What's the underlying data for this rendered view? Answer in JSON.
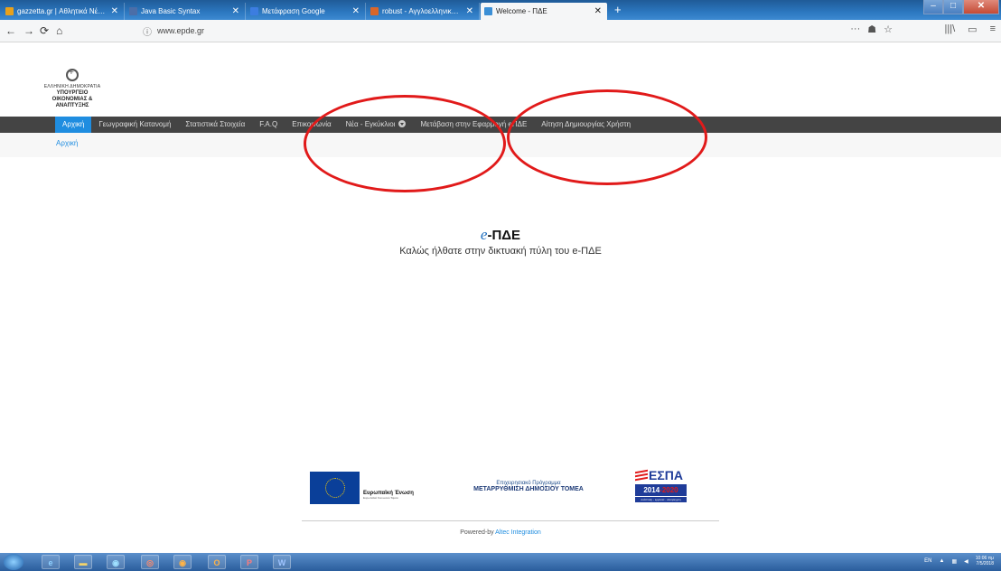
{
  "browser": {
    "tabs": [
      {
        "title": "gazzetta.gr | Αθλητικά Νέα | Εκ",
        "favicon_color": "#e8a11c"
      },
      {
        "title": "Java Basic Syntax",
        "favicon_color": "#4b6ea8"
      },
      {
        "title": "Μετάφραση Google",
        "favicon_color": "#3c7de0"
      },
      {
        "title": "robust - Αγγλοελληνικό Λεξικό",
        "favicon_color": "#d9662a"
      },
      {
        "title": "Welcome - ΠΔΕ",
        "favicon_color": "#3b8fd6"
      }
    ],
    "close_glyph": "✕",
    "new_tab_glyph": "+",
    "url": "www.epde.gr",
    "nav": {
      "back": "←",
      "forward": "→",
      "reload": "⟳",
      "home": "⌂",
      "info": "ⓘ"
    },
    "url_actions": [
      "···",
      "☗",
      "☆"
    ],
    "toolbar_icons": [
      "|||\\",
      "▭",
      "≡"
    ],
    "window_controls": {
      "min": "‒",
      "max": "□",
      "close": "✕"
    }
  },
  "site": {
    "logo": {
      "line1": "ΕΛΛΗΝΙΚΗ ΔΗΜΟΚΡΑΤΙΑ",
      "line2": "ΥΠΟΥΡΓΕΙΟ",
      "line3": "ΟΙΚΟΝΟΜΙΑΣ & ΑΝΑΠΤΥΞΗΣ"
    },
    "menu": [
      {
        "label": "Αρχική",
        "active": true
      },
      {
        "label": "Γεωγραφική Κατανομή"
      },
      {
        "label": "Στατιστικά Στοιχεία"
      },
      {
        "label": "F.A.Q"
      },
      {
        "label": "Επικοινωνία"
      },
      {
        "label": "Νέα - Εγκύκλιοι",
        "has_dropdown": true
      },
      {
        "label": "Μετάβαση στην Εφαρμογή eΠΔΕ"
      },
      {
        "label": "Αίτηση Δημιουργίας Χρήστη"
      }
    ],
    "breadcrumb": "Αρχική",
    "hero": {
      "title_prefix": "e",
      "title_main": "-ΠΔΕ",
      "subtitle": "Καλώς ήλθατε στην δικτυακή πύλη του e-ΠΔΕ"
    },
    "footer": {
      "eu_label": "Ευρωπαϊκή Ένωση",
      "eu_sublabel": "Ευρωπαϊκό Κοινωνικό Ταμείο",
      "op_line1": "Επιχειρησιακό Πρόγραμμα",
      "op_line2": "ΜΕΤΑΡΡΥΘΜΙΣΗ ΔΗΜΟΣΙΟΥ ΤΟΜΕΑ",
      "espa_word": "ΕΣΠΑ",
      "espa_years_a": "2014",
      "espa_years_b": "-2020",
      "espa_tagline": "ανάπτυξη - εργασία - αλληλεγγύη",
      "powered_prefix": "Powered-by",
      "powered_link": "Altec Integration"
    }
  },
  "taskbar": {
    "apps": [
      "e",
      "▬",
      "◉",
      "◎",
      "◉",
      "O",
      "P",
      "W"
    ],
    "tray": {
      "lang": "EN",
      "time": "10:06 πμ",
      "date": "7/5/2018"
    }
  },
  "colors": {
    "menu_bg": "#444444",
    "menu_active": "#1f8de0",
    "annotation_circle": "#e11a1a"
  }
}
